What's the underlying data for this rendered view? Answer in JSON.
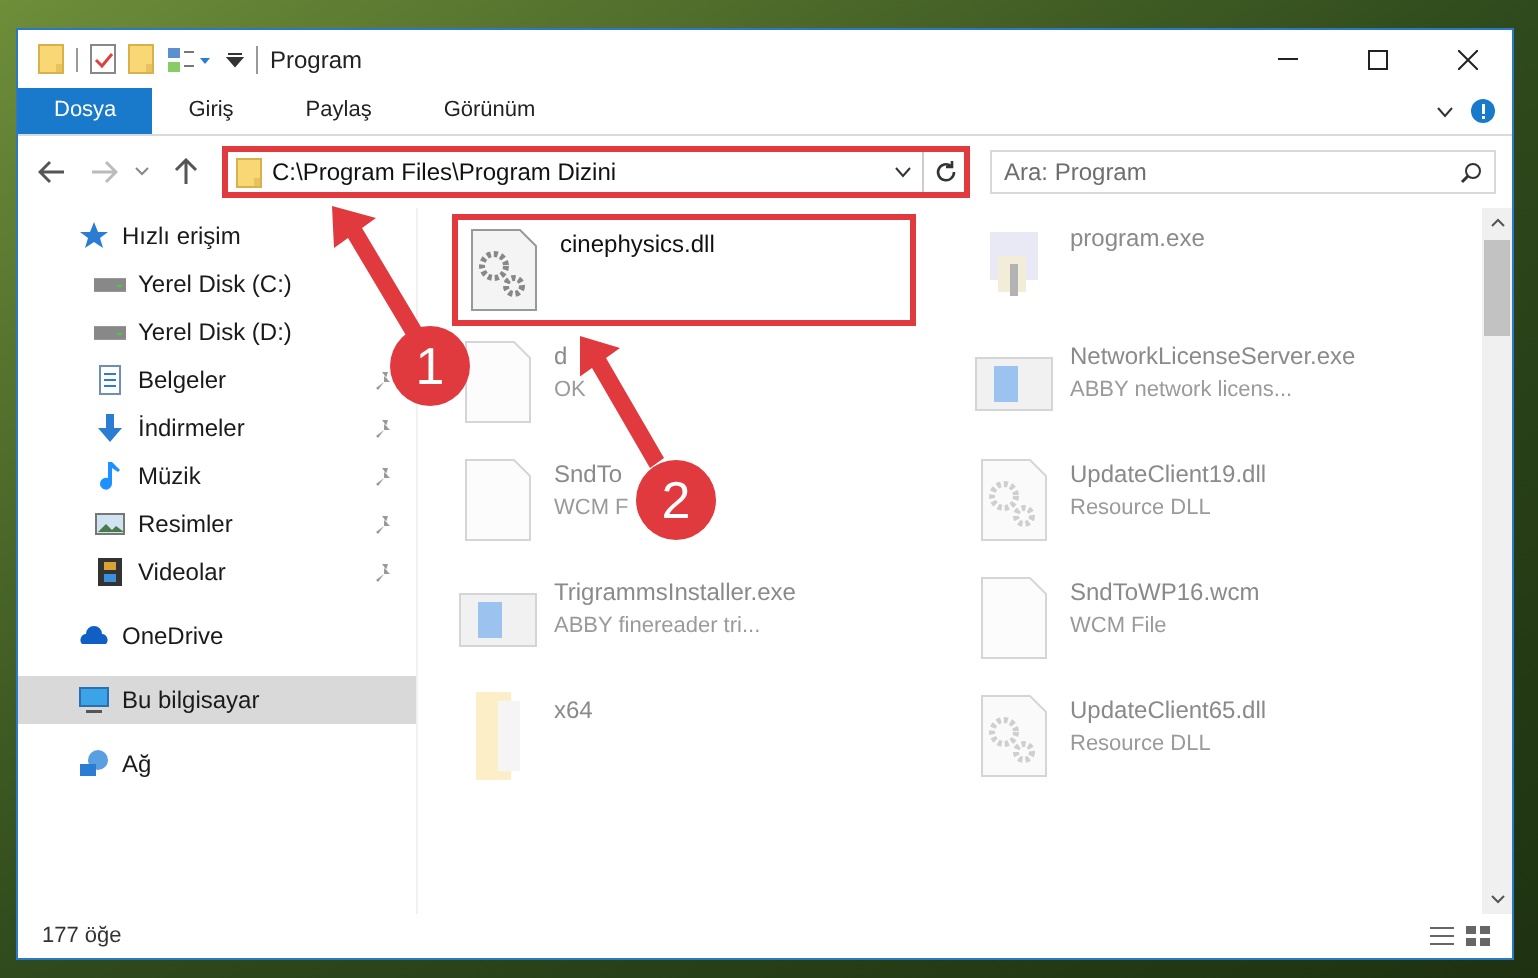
{
  "window": {
    "title": "Program"
  },
  "ribbon_tabs": [
    {
      "label": "Dosya",
      "selected": true
    },
    {
      "label": "Giriş",
      "selected": false
    },
    {
      "label": "Paylaş",
      "selected": false
    },
    {
      "label": "Görünüm",
      "selected": false
    }
  ],
  "address": {
    "path": "C:\\Program Files\\Program Dizini"
  },
  "search": {
    "placeholder": "Ara: Program"
  },
  "sidebar": {
    "items": [
      {
        "label": "Hızlı erişim",
        "kind": "quick-access",
        "selected": false,
        "children": [
          {
            "label": "Yerel Disk (C:)",
            "kind": "drive",
            "selected": false
          },
          {
            "label": "Yerel Disk (D:)",
            "kind": "drive",
            "selected": false
          },
          {
            "label": "Belgeler",
            "kind": "documents",
            "pinned": true,
            "selected": false
          },
          {
            "label": "İndirmeler",
            "kind": "downloads",
            "pinned": true,
            "selected": false
          },
          {
            "label": "Müzik",
            "kind": "music",
            "pinned": true,
            "selected": false
          },
          {
            "label": "Resimler",
            "kind": "pictures",
            "pinned": true,
            "selected": false
          },
          {
            "label": "Videolar",
            "kind": "videos",
            "pinned": true,
            "selected": false
          }
        ]
      },
      {
        "label": "OneDrive",
        "kind": "cloud",
        "selected": false
      },
      {
        "label": "Bu bilgisayar",
        "kind": "computer",
        "selected": true
      },
      {
        "label": "Ağ",
        "kind": "network",
        "selected": false
      }
    ]
  },
  "files": [
    {
      "name": "cinephysics.dll",
      "kind": "dll",
      "faded": false
    },
    {
      "name": "program.exe",
      "kind": "exe",
      "faded": true
    },
    {
      "name": "d",
      "detail": "OK",
      "kind": "blank",
      "faded": true
    },
    {
      "name": "NetworkLicenseServer.exe",
      "detail": "ABBY network licens...",
      "kind": "app",
      "faded": true
    },
    {
      "name": "SndTo",
      "detail": "WCM F",
      "kind": "blank",
      "faded": true
    },
    {
      "name": "UpdateClient19.dll",
      "detail": "Resource DLL",
      "kind": "dll",
      "faded": true
    },
    {
      "name": "TrigrammsInstaller.exe",
      "detail": "ABBY finereader tri...",
      "kind": "app",
      "faded": true
    },
    {
      "name": "SndToWP16.wcm",
      "detail": "WCM File",
      "kind": "blank",
      "faded": true
    },
    {
      "name": "x64",
      "kind": "folder",
      "faded": true
    },
    {
      "name": "UpdateClient65.dll",
      "detail": "Resource DLL",
      "kind": "dll",
      "faded": true
    }
  ],
  "status_bar": {
    "count": "177 öğe"
  },
  "annotations": [
    {
      "number": "1"
    },
    {
      "number": "2"
    }
  ]
}
